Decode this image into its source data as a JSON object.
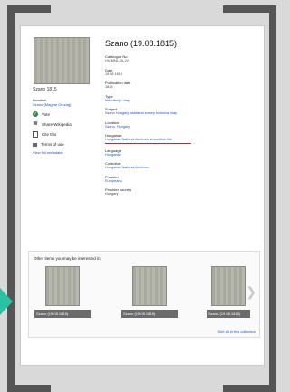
{
  "title": "Szano (19.08.1815)",
  "left": {
    "caption": "Szano 1815",
    "location_label": "Location",
    "location_value": "Szano (Magyar Orszag)",
    "actions": [
      {
        "icon": "green-circle-icon",
        "label": "Vote"
      },
      {
        "icon": "wikipedia-icon",
        "label": "Share Wikipedia"
      },
      {
        "icon": "document-icon",
        "label": "Cite this"
      },
      {
        "icon": "lock-icon",
        "label": "Terms of use"
      }
    ],
    "footer_link": "View full metadata"
  },
  "fields": [
    {
      "label": "Catalogue No.",
      "value": "HU-MNL-OL-IV"
    },
    {
      "label": "Date",
      "value": "19.08.1815"
    },
    {
      "label": "Publication date",
      "value": "1815"
    },
    {
      "label": "Type",
      "value": "Manuscript map",
      "link": true
    },
    {
      "label": "Subject",
      "value": "Szano Hungary cadastral survey historical map",
      "link": true
    },
    {
      "label": "Location",
      "value": "Szano, Hungary",
      "link": true
    },
    {
      "label": "Hungarian",
      "value": "Hungarian National Archives description link",
      "link": true,
      "red": true
    },
    {
      "label": "Language",
      "value": "Hungarian",
      "link": true
    },
    {
      "label": "Collection",
      "value": "Hungarian National Archives",
      "link": true
    },
    {
      "label": "Provider",
      "value": "Europeana",
      "link": true
    },
    {
      "label": "Provider country",
      "value": "Hungary"
    }
  ],
  "carousel": {
    "title": "Other items you may be interested in",
    "cards": [
      {
        "caption": "Szano (19.08.1815)"
      },
      {
        "caption": "Szano (19.08.1815)"
      },
      {
        "caption": "Szano (19.08.1815)"
      }
    ],
    "see_all": "See all in this collection"
  },
  "colors": {
    "link": "#1a56c8",
    "accent": "#29c2a5",
    "highlight": "#c62828"
  }
}
